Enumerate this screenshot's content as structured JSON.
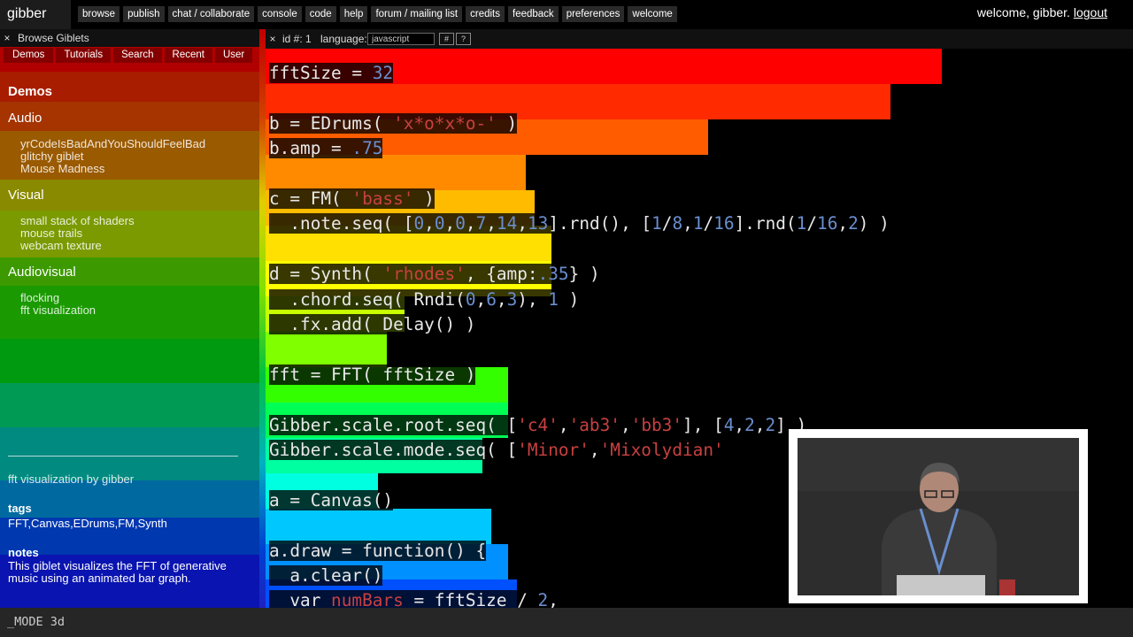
{
  "app": {
    "logo": "gibber"
  },
  "nav": [
    "browse",
    "publish",
    "chat / collaborate",
    "console",
    "code",
    "help",
    "forum / mailing list",
    "credits",
    "feedback",
    "preferences",
    "welcome"
  ],
  "user": {
    "welcome": "welcome, gibber.",
    "logout": "logout"
  },
  "sidebar": {
    "close": "×",
    "title": "Browse Giblets",
    "tabs": [
      "Demos",
      "Tutorials",
      "Search",
      "Recent",
      "User"
    ],
    "heading": "Demos",
    "categories": [
      {
        "title": "Audio",
        "items": [
          "yrCodeIsBadAndYouShouldFeelBad",
          "glitchy giblet",
          "Mouse Madness"
        ]
      },
      {
        "title": "Visual",
        "items": [
          "small stack of shaders",
          "mouse trails",
          "webcam texture"
        ]
      },
      {
        "title": "Audiovisual",
        "items": [
          "flocking",
          "fft visualization"
        ]
      }
    ],
    "giblet_byline": "fft visualization by gibber",
    "tags_label": "tags",
    "tags": "FFT,Canvas,EDrums,FM,Synth",
    "notes_label": "notes",
    "notes": "This giblet visualizes the FFT of generative music using an animated bar graph."
  },
  "editor": {
    "close": "×",
    "id_label": "id #: 1",
    "language_label": "language:",
    "language_value": "javascript",
    "btn_hash": "#",
    "btn_help": "?",
    "bar_colors": [
      "#ff0000",
      "#ff2a00",
      "#ff5c00",
      "#ff8a00",
      "#ffbb00",
      "#ffe000",
      "#ffff00",
      "#c8ff00",
      "#7fff00",
      "#33ff00",
      "#00ff55",
      "#00ffa0",
      "#00ffe0",
      "#00c8ff",
      "#0090ff",
      "#0050ff",
      "#0010ff"
    ],
    "bar_levels": [
      0.78,
      0.72,
      0.51,
      0.3,
      0.31,
      0.33,
      0.33,
      0.16,
      0.14,
      0.28,
      0.28,
      0.25,
      0.13,
      0.26,
      0.28,
      0.29,
      0.27
    ],
    "lines": [
      [
        {
          "t": "fftSize = ",
          "c": "p"
        },
        {
          "t": "32",
          "c": "n"
        }
      ],
      [],
      [
        {
          "t": "b = EDrums( ",
          "c": "p"
        },
        {
          "t": "'x*o*x*o-'",
          "c": "s"
        },
        {
          "t": " )",
          "c": "p"
        }
      ],
      [
        {
          "t": "b.amp = ",
          "c": "p"
        },
        {
          "t": ".75",
          "c": "n"
        }
      ],
      [],
      [
        {
          "t": "c = FM( ",
          "c": "p"
        },
        {
          "t": "'bass'",
          "c": "s"
        },
        {
          "t": " )",
          "c": "p"
        }
      ],
      [
        {
          "t": "  .note.seq( [",
          "c": "p"
        },
        {
          "t": "0",
          "c": "n"
        },
        {
          "t": ",",
          "c": "p"
        },
        {
          "t": "0",
          "c": "n"
        },
        {
          "t": ",",
          "c": "p"
        },
        {
          "t": "0",
          "c": "n"
        },
        {
          "t": ",",
          "c": "p"
        },
        {
          "t": "7",
          "c": "n"
        },
        {
          "t": ",",
          "c": "p"
        },
        {
          "t": "14",
          "c": "n"
        },
        {
          "t": ",",
          "c": "p"
        },
        {
          "t": "13",
          "c": "n"
        },
        {
          "t": "].rnd(), [",
          "c": "p"
        },
        {
          "t": "1",
          "c": "n"
        },
        {
          "t": "/",
          "c": "p"
        },
        {
          "t": "8",
          "c": "n"
        },
        {
          "t": ",",
          "c": "p"
        },
        {
          "t": "1",
          "c": "n"
        },
        {
          "t": "/",
          "c": "p"
        },
        {
          "t": "16",
          "c": "n"
        },
        {
          "t": "].rnd(",
          "c": "p"
        },
        {
          "t": "1",
          "c": "n"
        },
        {
          "t": "/",
          "c": "p"
        },
        {
          "t": "16",
          "c": "n"
        },
        {
          "t": ",",
          "c": "p"
        },
        {
          "t": "2",
          "c": "n"
        },
        {
          "t": ") )",
          "c": "p"
        }
      ],
      [],
      [
        {
          "t": "d = Synth( ",
          "c": "p"
        },
        {
          "t": "'rhodes'",
          "c": "s"
        },
        {
          "t": ", {amp:",
          "c": "p"
        },
        {
          "t": ".35",
          "c": "n"
        },
        {
          "t": "} )",
          "c": "p"
        }
      ],
      [
        {
          "t": "  .chord.seq( Rndi(",
          "c": "p"
        },
        {
          "t": "0",
          "c": "n"
        },
        {
          "t": ",",
          "c": "p"
        },
        {
          "t": "6",
          "c": "n"
        },
        {
          "t": ",",
          "c": "p"
        },
        {
          "t": "3",
          "c": "n"
        },
        {
          "t": "), ",
          "c": "p"
        },
        {
          "t": "1",
          "c": "n"
        },
        {
          "t": " )",
          "c": "p"
        }
      ],
      [
        {
          "t": "  .fx.add( Delay() )",
          "c": "p"
        }
      ],
      [],
      [
        {
          "t": "fft = FFT( fftSize )",
          "c": "p"
        }
      ],
      [],
      [
        {
          "t": "Gibber.scale.root.seq( [",
          "c": "p"
        },
        {
          "t": "'c4'",
          "c": "s"
        },
        {
          "t": ",",
          "c": "p"
        },
        {
          "t": "'ab3'",
          "c": "s"
        },
        {
          "t": ",",
          "c": "p"
        },
        {
          "t": "'bb3'",
          "c": "s"
        },
        {
          "t": "], [",
          "c": "p"
        },
        {
          "t": "4",
          "c": "n"
        },
        {
          "t": ",",
          "c": "p"
        },
        {
          "t": "2",
          "c": "n"
        },
        {
          "t": ",",
          "c": "p"
        },
        {
          "t": "2",
          "c": "n"
        },
        {
          "t": "] )",
          "c": "p"
        }
      ],
      [
        {
          "t": "Gibber.scale.mode.seq( [",
          "c": "p"
        },
        {
          "t": "'Minor'",
          "c": "s"
        },
        {
          "t": ",",
          "c": "p"
        },
        {
          "t": "'Mixolydian'",
          "c": "s"
        }
      ],
      [],
      [
        {
          "t": "a = Canvas()",
          "c": "p"
        }
      ],
      [],
      [
        {
          "t": "a.draw = function() {",
          "c": "p"
        }
      ],
      [
        {
          "t": "  a.clear()",
          "c": "p"
        }
      ],
      [
        {
          "t": "  var ",
          "c": "p"
        },
        {
          "t": "numBars",
          "c": "s"
        },
        {
          "t": " = fftSize / ",
          "c": "p"
        },
        {
          "t": "2",
          "c": "n"
        },
        {
          "t": ",",
          "c": "p"
        }
      ]
    ]
  },
  "status": {
    "mode": "_MODE 3d"
  }
}
